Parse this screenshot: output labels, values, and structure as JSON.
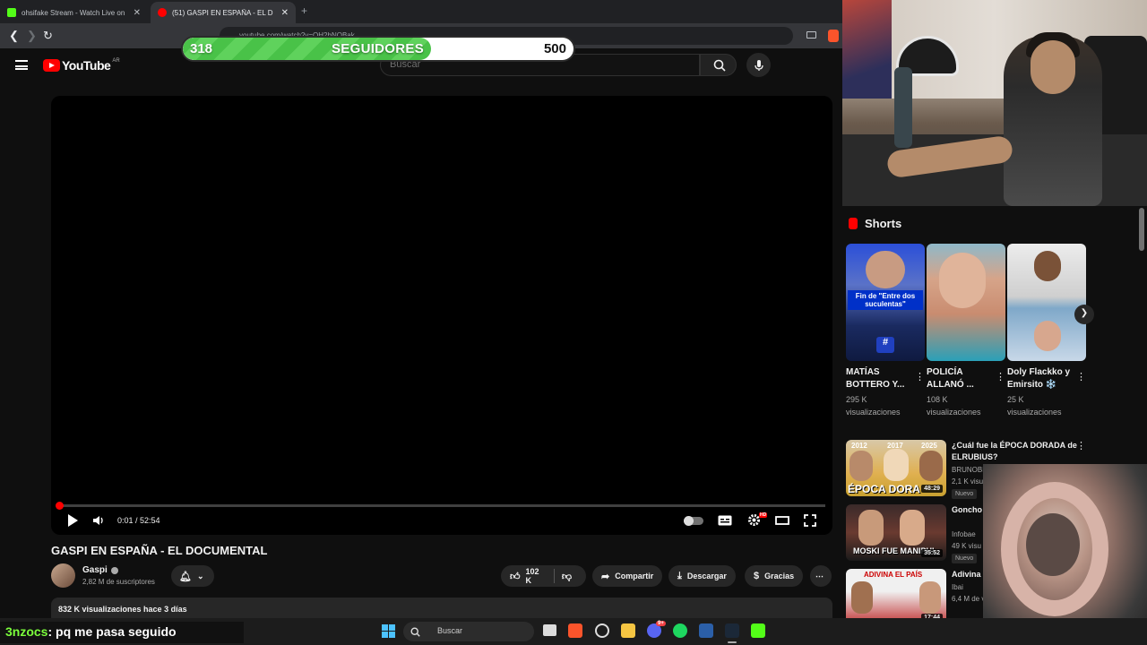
{
  "browser": {
    "tabs": [
      {
        "label": "ohsifake Stream - Watch Live on"
      },
      {
        "label": "(51) GASPI EN ESPAÑA - EL D",
        "active": true
      }
    ],
    "url": "youtube.com/watch?v=QH2bNQBak"
  },
  "follower_goal": {
    "current": "318",
    "label": "SEGUIDORES",
    "target": "500",
    "progress": 0.636
  },
  "masthead": {
    "logo": "YouTube",
    "country": "AR",
    "search_placeholder": "Buscar"
  },
  "player": {
    "time": "0:01 / 52:54",
    "progress": 0.0003
  },
  "video": {
    "title": "GASPI EN ESPAÑA - EL DOCUMENTAL",
    "channel": "Gaspi",
    "subscribers": "2,82 M de suscriptores",
    "likes": "102 K",
    "share": "Compartir",
    "download": "Descargar",
    "thanks": "Gracias",
    "views_date": "832 K visualizaciones  hace 3 días"
  },
  "shorts": {
    "heading": "Shorts",
    "items": [
      {
        "title": "MATÍAS BOTTERO Y...",
        "views": "295 K visualizaciones",
        "caption": "Fin de \"Entre dos suculentas\""
      },
      {
        "title": "POLICÍA ALLANÓ ...",
        "views": "108 K visualizaciones"
      },
      {
        "title": "Doly Flackko y Emirsito ❄️",
        "views": "25 K visualizaciones"
      }
    ]
  },
  "recommendations": [
    {
      "title": "¿Cuál fue la ÉPOCA DORADA de ELRUBIUS?",
      "channel": "BRUNOBK",
      "meta": "2,1 K visu",
      "badge": "Nuevo",
      "duration": "48:29",
      "thumb_text": "ÉPOCA DORA",
      "years": [
        "2012",
        "2017",
        "2025"
      ]
    },
    {
      "title": "Goncho salida de",
      "channel": "Infobae",
      "meta": "49 K visu",
      "badge": "Nuevo",
      "duration": "35:52",
      "thumb_text": "MOSKI FUE MANIPUL"
    },
    {
      "title": "Adivina E",
      "channel": "Ibai",
      "meta": "6,4 M de v",
      "duration": "17:44",
      "thumb_text": "ADIVINA EL PAÍS"
    }
  ],
  "taskbar": {
    "search": "Buscar",
    "chat_user": "3nzocs",
    "chat_message": ": pq me pasa seguido",
    "discord_badge": "9+"
  },
  "colors": {
    "yt_red": "#ff0000",
    "goal_green": "#49c248",
    "background": "#0f0f0f"
  }
}
